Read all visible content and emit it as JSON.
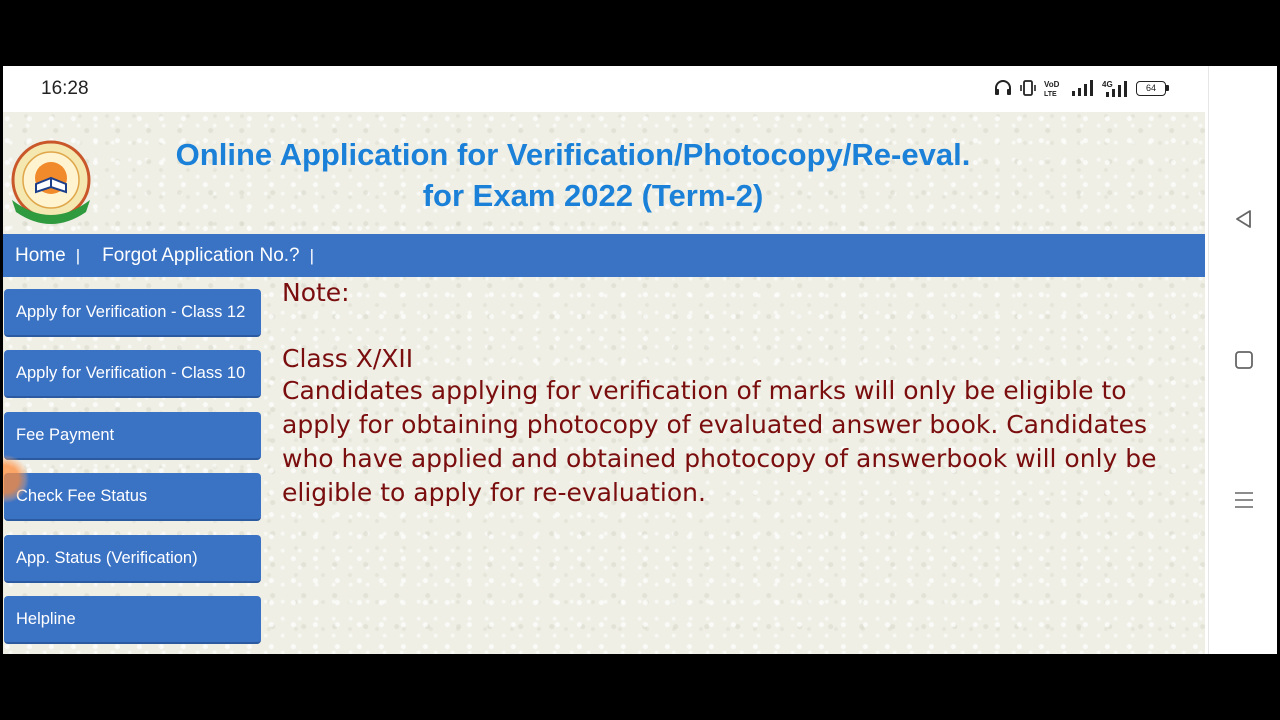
{
  "status_bar": {
    "time": "16:28",
    "network_label": "4G",
    "volte_label": "VoLTE",
    "battery_level": "64"
  },
  "header": {
    "title_line1": "Online Application for Verification/Photocopy/Re-eval.",
    "title_line2": "for Exam 2022 (Term-2)"
  },
  "nav": {
    "home": "Home",
    "forgot": "Forgot Application No.?",
    "separator": "|"
  },
  "sidebar": {
    "items": [
      {
        "label": "Apply for Verification - Class 12"
      },
      {
        "label": "Apply for Verification - Class 10"
      },
      {
        "label": "Fee Payment"
      },
      {
        "label": "Check Fee Status"
      },
      {
        "label": "App. Status (Verification)"
      },
      {
        "label": "Helpline"
      }
    ]
  },
  "note": {
    "heading": "Note:",
    "class_label": "Class X/XII",
    "body": "Candidates applying for verification of marks will only be eligible to apply for obtaining photocopy of evaluated answer book. Candidates who have applied and obtained photocopy of answerbook will only be eligible to apply for re-evaluation."
  },
  "icons": {
    "headset": "headset-icon",
    "vibrate": "vibrate-icon",
    "volte": "volte-icon",
    "signal": "signal-icon",
    "battery": "battery-icon",
    "back": "back-triangle-icon",
    "home": "home-square-icon",
    "recents": "recents-menu-icon"
  },
  "colors": {
    "title": "#1a80d8",
    "navbar": "#3a72c4",
    "note_text": "#7a0d0d",
    "background": "#efefe6"
  }
}
